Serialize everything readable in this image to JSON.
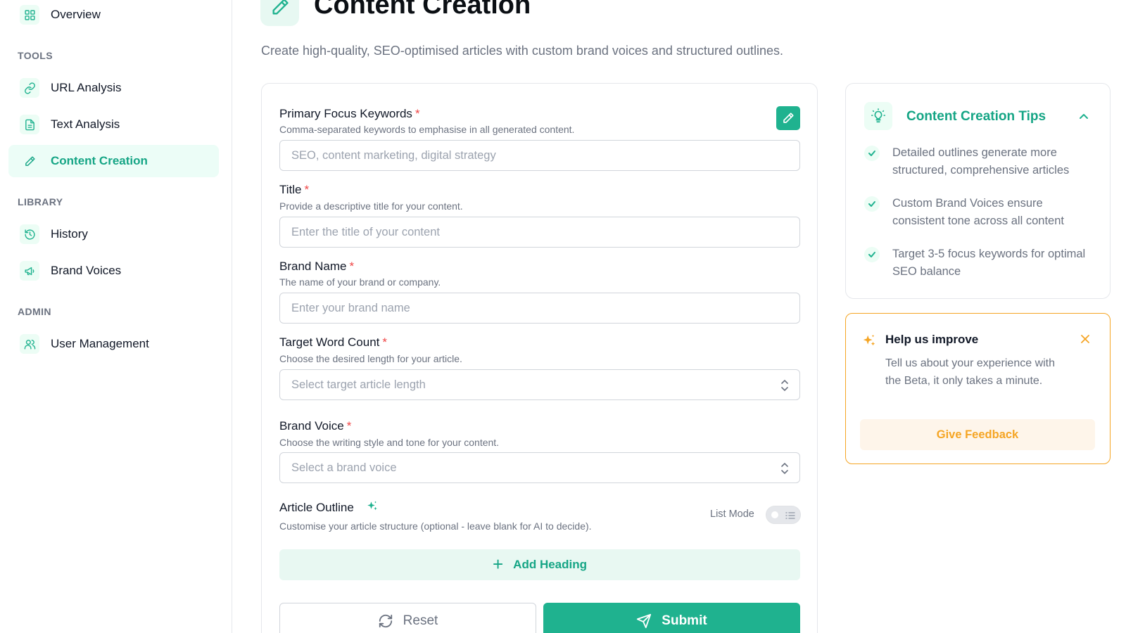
{
  "sidebar": {
    "overview": "Overview",
    "sections": {
      "tools": "TOOLS",
      "library": "LIBRARY",
      "admin": "ADMIN"
    },
    "items": {
      "url_analysis": "URL Analysis",
      "text_analysis": "Text Analysis",
      "content_creation": "Content Creation",
      "history": "History",
      "brand_voices": "Brand Voices",
      "user_management": "User Management"
    },
    "icons": [
      "grid-icon",
      "link-icon",
      "document-icon",
      "pencil-icon",
      "history-icon",
      "megaphone-icon",
      "users-icon"
    ],
    "active_item": "Content Creation"
  },
  "header": {
    "title": "Content Creation",
    "subtitle": "Create high-quality, SEO-optimised articles with custom brand voices and structured outlines."
  },
  "form": {
    "keywords": {
      "label": "Primary Focus Keywords",
      "required": "*",
      "help": "Comma-separated keywords to emphasise in all generated content.",
      "placeholder": "SEO, content marketing, digital strategy"
    },
    "title": {
      "label": "Title",
      "required": "*",
      "help": "Provide a descriptive title for your content.",
      "placeholder": "Enter the title of your content"
    },
    "brand_name": {
      "label": "Brand Name",
      "required": "*",
      "help": "The name of your brand or company.",
      "placeholder": "Enter your brand name"
    },
    "word_count": {
      "label": "Target Word Count",
      "required": "*",
      "help": "Choose the desired length for your article.",
      "placeholder": "Select target article length"
    },
    "brand_voice": {
      "label": "Brand Voice",
      "required": "*",
      "help": "Choose the writing style and tone for your content.",
      "placeholder": "Select a brand voice"
    },
    "outline": {
      "label": "Article Outline",
      "help": "Customise your article structure (optional - leave blank for AI to decide).",
      "list_mode_label": "List Mode",
      "list_mode_on": false,
      "add_heading": "Add Heading"
    },
    "reset_label": "Reset",
    "submit_label": "Submit"
  },
  "tips": {
    "title": "Content Creation Tips",
    "items": [
      "Detailed outlines generate more structured, comprehensive articles",
      "Custom Brand Voices ensure consistent tone across all content",
      "Target 3-5 focus keywords for optimal SEO balance"
    ]
  },
  "feedback": {
    "title": "Help us improve",
    "text": "Tell us about your experience with the Beta, it only takes a minute.",
    "button": "Give Feedback"
  },
  "colors": {
    "accent": "#1fb28f",
    "accent_text": "#15a585",
    "warning": "#f5a524",
    "required": "#ef4444"
  }
}
